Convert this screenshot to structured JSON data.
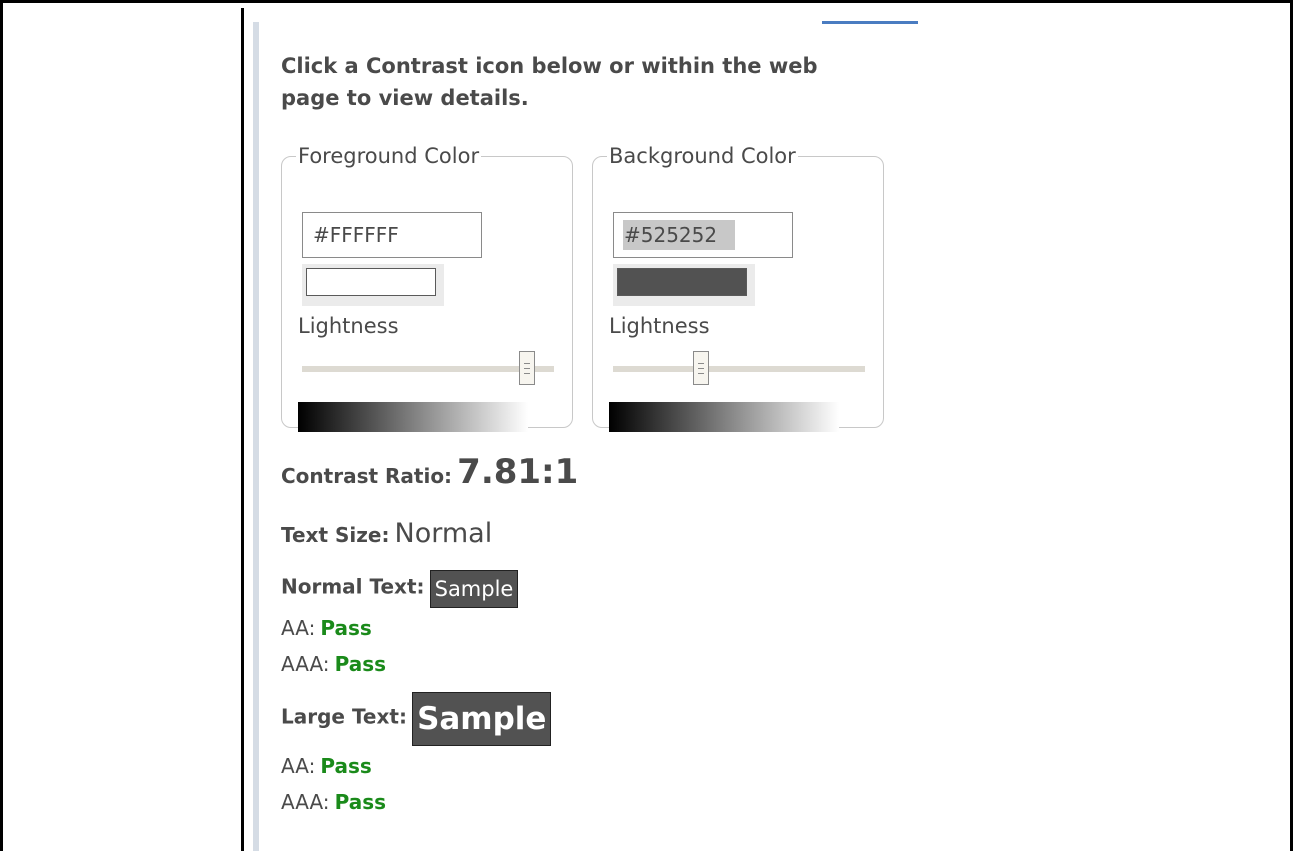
{
  "instructions": "Click a Contrast icon below or within the web page to view details.",
  "foreground": {
    "legend": "Foreground Color",
    "hex_value": "#FFFFFF",
    "color": "#FFFFFF",
    "lightness_label": "Lightness",
    "lightness_percent": 92
  },
  "background": {
    "legend": "Background Color",
    "hex_value": "#525252",
    "color": "#525252",
    "lightness_label": "Lightness",
    "lightness_percent": 34
  },
  "results": {
    "contrast_label": "Contrast Ratio:",
    "contrast_value": "7.81:1",
    "text_size_label": "Text Size:",
    "text_size_value": "Normal",
    "normal_text_label": "Normal Text:",
    "large_text_label": "Large Text:",
    "sample_label": "Sample",
    "normal": {
      "aa_label": "AA:",
      "aa_result": "Pass",
      "aaa_label": "AAA:",
      "aaa_result": "Pass"
    },
    "large": {
      "aa_label": "AA:",
      "aa_result": "Pass",
      "aaa_label": "AAA:",
      "aaa_result": "Pass"
    }
  },
  "colors": {
    "pass": "#1a8a1a",
    "accent": "#4a7cc1"
  }
}
